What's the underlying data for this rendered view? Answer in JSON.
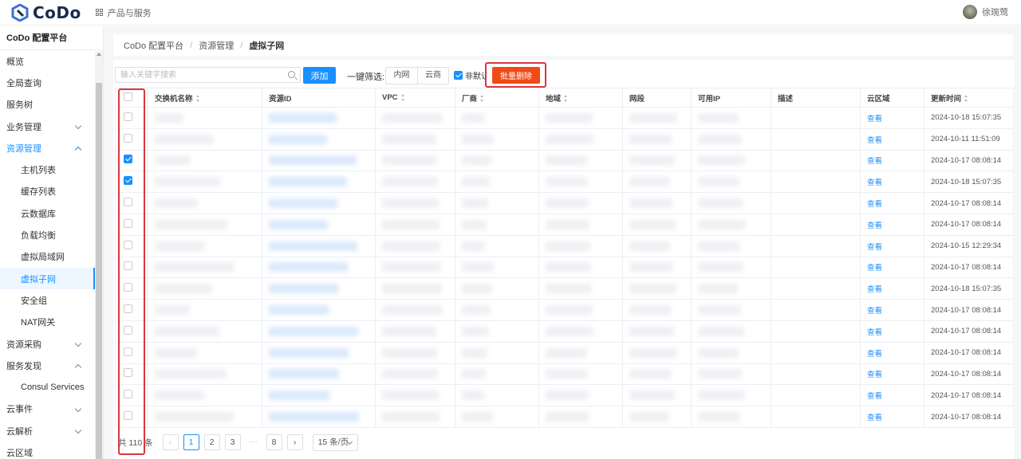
{
  "app": {
    "name": "CoDo",
    "product_menu": "产品与服务",
    "user_name": "徐琬莺"
  },
  "sidebar": {
    "title": "CoDo 配置平台",
    "items": [
      {
        "label": "概览",
        "level": 0
      },
      {
        "label": "全局查询",
        "level": 0
      },
      {
        "label": "服务树",
        "level": 0
      },
      {
        "label": "业务管理",
        "level": 0,
        "chevron": "down"
      },
      {
        "label": "资源管理",
        "level": 0,
        "chevron": "up",
        "open": true
      },
      {
        "label": "主机列表",
        "level": 1
      },
      {
        "label": "缓存列表",
        "level": 1
      },
      {
        "label": "云数据库",
        "level": 1
      },
      {
        "label": "负载均衡",
        "level": 1
      },
      {
        "label": "虚拟局域网",
        "level": 1
      },
      {
        "label": "虚拟子网",
        "level": 1,
        "active": true
      },
      {
        "label": "安全组",
        "level": 1
      },
      {
        "label": "NAT网关",
        "level": 1
      },
      {
        "label": "资源采购",
        "level": 0,
        "chevron": "down"
      },
      {
        "label": "服务发现",
        "level": 0,
        "chevron": "up"
      },
      {
        "label": "Consul Services",
        "level": 1
      },
      {
        "label": "云事件",
        "level": 0,
        "chevron": "down"
      },
      {
        "label": "云解析",
        "level": 0,
        "chevron": "down"
      },
      {
        "label": "云区域",
        "level": 0
      }
    ]
  },
  "breadcrumb": [
    "CoDo 配置平台",
    "资源管理",
    "虚拟子网"
  ],
  "toolbar": {
    "search_placeholder": "输入关键字搜索",
    "add_label": "添加",
    "filter_label": "一键筛选:",
    "filter_options": [
      "内网",
      "云商"
    ],
    "default_checkbox_label": "非默认",
    "default_checked": true,
    "bulk_delete_label": "批量删除"
  },
  "table": {
    "columns": [
      "交换机名称",
      "资源ID",
      "VPC",
      "厂商",
      "地域",
      "网段",
      "可用IP",
      "描述",
      "云区域",
      "更新时间"
    ],
    "sortable": [
      true,
      false,
      true,
      true,
      true,
      false,
      false,
      false,
      false,
      true
    ],
    "view_label": "查看",
    "rows": [
      {
        "checked": false,
        "updated": "2024-10-18 15:07:35"
      },
      {
        "checked": false,
        "updated": "2024-10-11 11:51:09"
      },
      {
        "checked": true,
        "updated": "2024-10-17 08:08:14"
      },
      {
        "checked": true,
        "updated": "2024-10-18 15:07:35"
      },
      {
        "checked": false,
        "updated": "2024-10-17 08:08:14"
      },
      {
        "checked": false,
        "updated": "2024-10-17 08:08:14"
      },
      {
        "checked": false,
        "updated": "2024-10-15 12:29:34"
      },
      {
        "checked": false,
        "updated": "2024-10-17 08:08:14"
      },
      {
        "checked": false,
        "updated": "2024-10-18 15:07:35"
      },
      {
        "checked": false,
        "updated": "2024-10-17 08:08:14"
      },
      {
        "checked": false,
        "updated": "2024-10-17 08:08:14"
      },
      {
        "checked": false,
        "updated": "2024-10-17 08:08:14"
      },
      {
        "checked": false,
        "updated": "2024-10-17 08:08:14"
      },
      {
        "checked": false,
        "updated": "2024-10-17 08:08:14"
      },
      {
        "checked": false,
        "updated": "2024-10-17 08:08:14"
      }
    ]
  },
  "pagination": {
    "total_label": "共 110 条",
    "pages": [
      "1",
      "2",
      "3",
      "···",
      "8"
    ],
    "current": "1",
    "page_size_label": "15 条/页"
  },
  "colors": {
    "accent": "#1890ff",
    "danger": "#f04b16",
    "highlight": "#d9363e",
    "brand": "#1b2a4e"
  }
}
